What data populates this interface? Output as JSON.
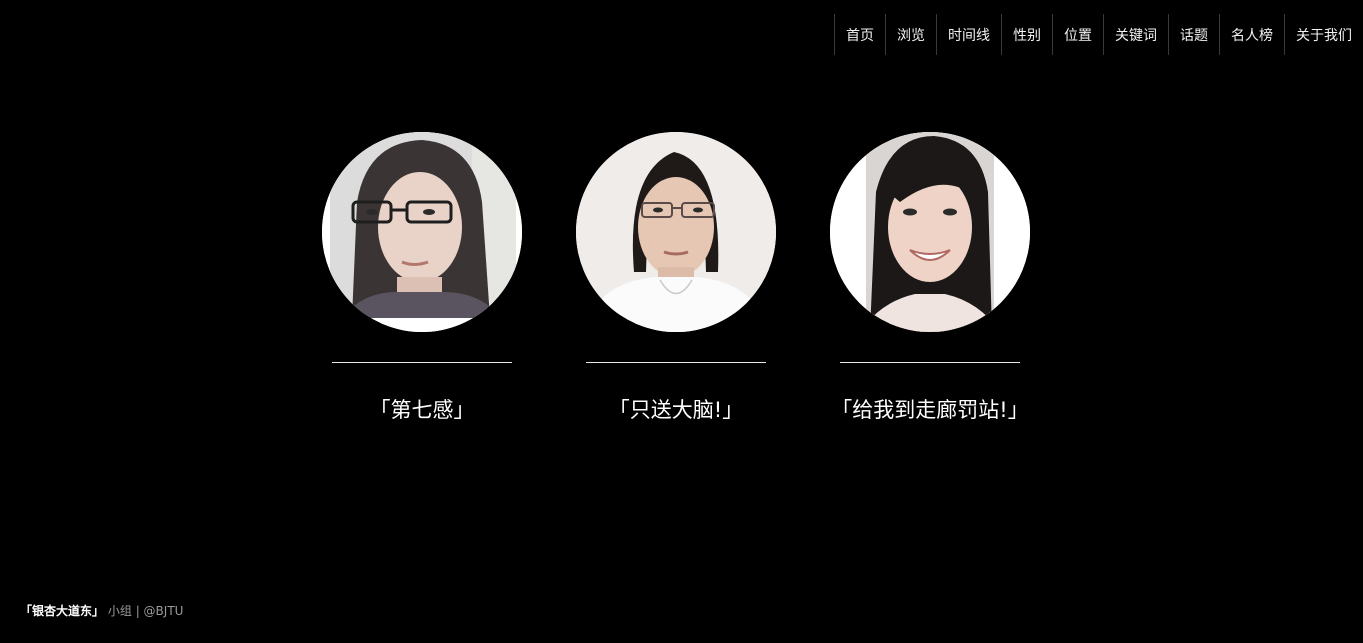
{
  "nav": {
    "items": [
      {
        "label": "首页"
      },
      {
        "label": "浏览"
      },
      {
        "label": "时间线"
      },
      {
        "label": "性别"
      },
      {
        "label": "位置"
      },
      {
        "label": "关键词"
      },
      {
        "label": "话题"
      },
      {
        "label": "名人榜"
      },
      {
        "label": "关于我们"
      }
    ]
  },
  "members": [
    {
      "caption": "「第七感」"
    },
    {
      "caption": "「只送大脑!」"
    },
    {
      "caption": "「给我到走廊罚站!」"
    }
  ],
  "footer": {
    "brand": "「银杏大道东」",
    "group": "小组",
    "separator": " | ",
    "school": "@BJTU"
  }
}
